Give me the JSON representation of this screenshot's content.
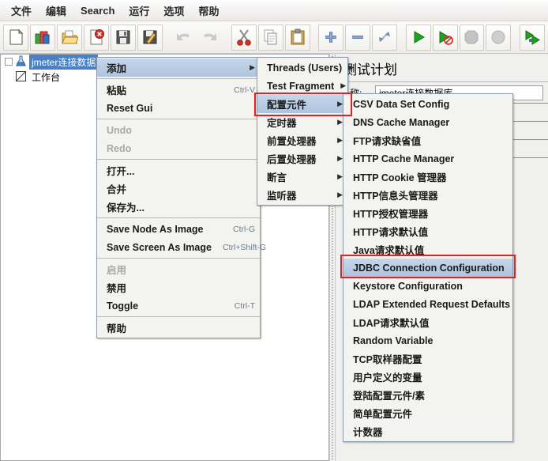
{
  "menubar": {
    "items": [
      {
        "label": "文件"
      },
      {
        "label": "编辑"
      },
      {
        "label": "Search"
      },
      {
        "label": "运行"
      },
      {
        "label": "选项"
      },
      {
        "label": "帮助"
      }
    ]
  },
  "toolbar": {
    "buttons": [
      {
        "name": "new-icon",
        "title": "新建"
      },
      {
        "name": "templates-icon",
        "title": "模板"
      },
      {
        "name": "open-icon",
        "title": "打开"
      },
      {
        "name": "close-icon",
        "title": "关闭"
      },
      {
        "name": "save-icon",
        "title": "保存"
      },
      {
        "name": "save-as-icon",
        "title": "保存为"
      },
      {
        "name": "undo-icon",
        "title": "Undo"
      },
      {
        "name": "redo-icon",
        "title": "Redo"
      },
      {
        "name": "cut-icon",
        "title": "剪切"
      },
      {
        "name": "copy-icon",
        "title": "复制"
      },
      {
        "name": "paste-icon",
        "title": "粘贴"
      },
      {
        "name": "expand-all-icon",
        "title": "展开全部"
      },
      {
        "name": "collapse-all-icon",
        "title": "折叠全部"
      },
      {
        "name": "toggle-icon",
        "title": "Toggle"
      },
      {
        "name": "start-icon",
        "title": "启动"
      },
      {
        "name": "start-no-pauses-icon",
        "title": "无间隔启动"
      },
      {
        "name": "stop-icon",
        "title": "停止"
      },
      {
        "name": "shutdown-icon",
        "title": "关闭"
      },
      {
        "name": "remote-start-all-icon",
        "title": "远程启动全部"
      }
    ]
  },
  "tree": {
    "nodes": [
      {
        "label": "jmeter连接数据",
        "icon": "test-plan-icon",
        "selected": true
      },
      {
        "label": "工作台",
        "icon": "workbench-icon",
        "selected": false
      }
    ]
  },
  "right_panel": {
    "title": "测试计划",
    "name_label": "名称:",
    "name_value": "jmeter连接数据库"
  },
  "context_menu": {
    "items": [
      {
        "label": "添加",
        "accel": "",
        "arrow": true,
        "selected": true,
        "disabled": false
      },
      {
        "type": "separator"
      },
      {
        "label": "粘贴",
        "accel": "Ctrl-V",
        "arrow": false,
        "selected": false,
        "disabled": false
      },
      {
        "label": "Reset Gui",
        "accel": "",
        "arrow": false,
        "selected": false,
        "disabled": false
      },
      {
        "type": "separator"
      },
      {
        "label": "Undo",
        "accel": "",
        "arrow": false,
        "selected": false,
        "disabled": true
      },
      {
        "label": "Redo",
        "accel": "",
        "arrow": false,
        "selected": false,
        "disabled": true
      },
      {
        "type": "separator"
      },
      {
        "label": "打开...",
        "accel": "",
        "arrow": false,
        "selected": false,
        "disabled": false
      },
      {
        "label": "合并",
        "accel": "",
        "arrow": false,
        "selected": false,
        "disabled": false
      },
      {
        "label": "保存为...",
        "accel": "",
        "arrow": false,
        "selected": false,
        "disabled": false
      },
      {
        "type": "separator"
      },
      {
        "label": "Save Node As Image",
        "accel": "Ctrl-G",
        "arrow": false,
        "selected": false,
        "disabled": false
      },
      {
        "label": "Save Screen As Image",
        "accel": "Ctrl+Shift-G",
        "arrow": false,
        "selected": false,
        "disabled": false
      },
      {
        "type": "separator"
      },
      {
        "label": "启用",
        "accel": "",
        "arrow": false,
        "selected": false,
        "disabled": true
      },
      {
        "label": "禁用",
        "accel": "",
        "arrow": false,
        "selected": false,
        "disabled": false
      },
      {
        "label": "Toggle",
        "accel": "Ctrl-T",
        "arrow": false,
        "selected": false,
        "disabled": false
      },
      {
        "type": "separator"
      },
      {
        "label": "帮助",
        "accel": "",
        "arrow": false,
        "selected": false,
        "disabled": false
      }
    ]
  },
  "add_submenu": {
    "items": [
      {
        "label": "Threads (Users)",
        "arrow": true,
        "selected": false
      },
      {
        "label": "Test Fragment",
        "arrow": true,
        "selected": false
      },
      {
        "label": "配置元件",
        "arrow": true,
        "selected": true
      },
      {
        "label": "定时器",
        "arrow": true,
        "selected": false
      },
      {
        "label": "前置处理器",
        "arrow": true,
        "selected": false
      },
      {
        "label": "后置处理器",
        "arrow": true,
        "selected": false
      },
      {
        "label": "断言",
        "arrow": true,
        "selected": false
      },
      {
        "label": "监听器",
        "arrow": true,
        "selected": false
      }
    ]
  },
  "config_submenu": {
    "items": [
      {
        "label": "CSV Data Set Config",
        "selected": false
      },
      {
        "label": "DNS Cache Manager",
        "selected": false
      },
      {
        "label": "FTP请求缺省值",
        "selected": false
      },
      {
        "label": "HTTP Cache Manager",
        "selected": false
      },
      {
        "label": "HTTP Cookie 管理器",
        "selected": false
      },
      {
        "label": "HTTP信息头管理器",
        "selected": false
      },
      {
        "label": "HTTP授权管理器",
        "selected": false
      },
      {
        "label": "HTTP请求默认值",
        "selected": false
      },
      {
        "label": "Java请求默认值",
        "selected": false
      },
      {
        "label": "JDBC Connection Configuration",
        "selected": true
      },
      {
        "label": "Keystore Configuration",
        "selected": false
      },
      {
        "label": "LDAP Extended Request Defaults",
        "selected": false
      },
      {
        "label": "LDAP请求默认值",
        "selected": false
      },
      {
        "label": "Random Variable",
        "selected": false
      },
      {
        "label": "TCP取样器配置",
        "selected": false
      },
      {
        "label": "用户定义的变量",
        "selected": false
      },
      {
        "label": "登陆配置元件/素",
        "selected": false
      },
      {
        "label": "简单配置元件",
        "selected": false
      },
      {
        "label": "计数器",
        "selected": false
      }
    ]
  },
  "annotations": {
    "highlight_color": "#ee1c20",
    "boxes": [
      {
        "name": "config-element-highlight",
        "target": "配置元件"
      },
      {
        "name": "jdbc-connection-configuration-highlight",
        "target": "JDBC Connection Configuration"
      }
    ]
  },
  "colors": {
    "selection_blue": "#4a80c4",
    "menu_selection": "#aec4de",
    "panel_bg": "#f0f0ee",
    "accent_red": "#ee1c20"
  }
}
